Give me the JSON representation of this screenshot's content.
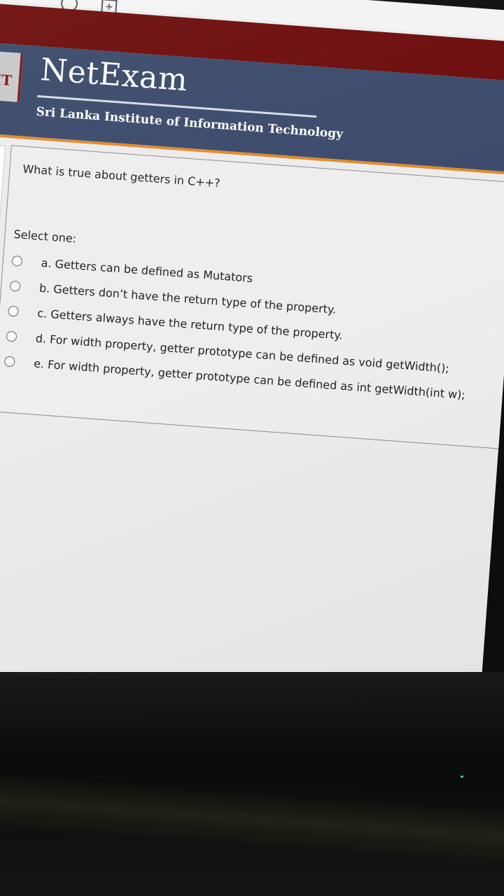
{
  "browser": {
    "icons": [
      "refresh-icon",
      "new-tab-icon"
    ]
  },
  "header": {
    "brand": "NetExam",
    "institute": "Sri Lanka Institute of Information Technology",
    "logo_text": "IT"
  },
  "question": {
    "text": "What is true about getters in C++?",
    "select_label": "Select one:",
    "options": [
      {
        "label": "a. Getters can be defined as Mutators",
        "selected": false
      },
      {
        "label": "b. Getters don’t have the return type of the property.",
        "selected": false
      },
      {
        "label": "c. Getters always have the return type of the property.",
        "selected": false
      },
      {
        "label": "d. For width property, getter prototype can be defined as void getWidth();",
        "selected": false
      },
      {
        "label": "e. For width property, getter prototype can be defined as int getWidth(int w);",
        "selected": false
      }
    ]
  },
  "colors": {
    "top_bar": "#6d0c0c",
    "header": "#3b4a6b",
    "accent": "#e08a2a",
    "page_bg": "#ececec"
  }
}
